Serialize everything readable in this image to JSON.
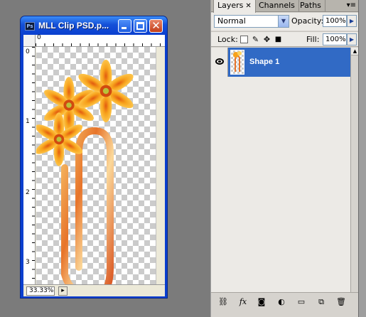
{
  "document": {
    "title": "MLL Clip PSD.p...",
    "ps_badge": "Ps",
    "zoom": "33.33%",
    "ruler_top": [
      "0"
    ],
    "ruler_left": [
      "0",
      "1",
      "2",
      "3"
    ]
  },
  "layers_panel": {
    "tabs": [
      {
        "label": "Layers",
        "active": true,
        "closable": true
      },
      {
        "label": "Channels",
        "active": false
      },
      {
        "label": "Paths",
        "active": false
      }
    ],
    "blend_mode": "Normal",
    "opacity_label": "Opacity:",
    "opacity_value": "100%",
    "lock_label": "Lock:",
    "fill_label": "Fill:",
    "fill_value": "100%",
    "layers": [
      {
        "name": "Shape 1",
        "visible": true,
        "selected": true
      }
    ]
  },
  "colors": {
    "titlebar": "#0a3fcf",
    "selection": "#316ac5",
    "petal_orange": "#f4a21b"
  }
}
